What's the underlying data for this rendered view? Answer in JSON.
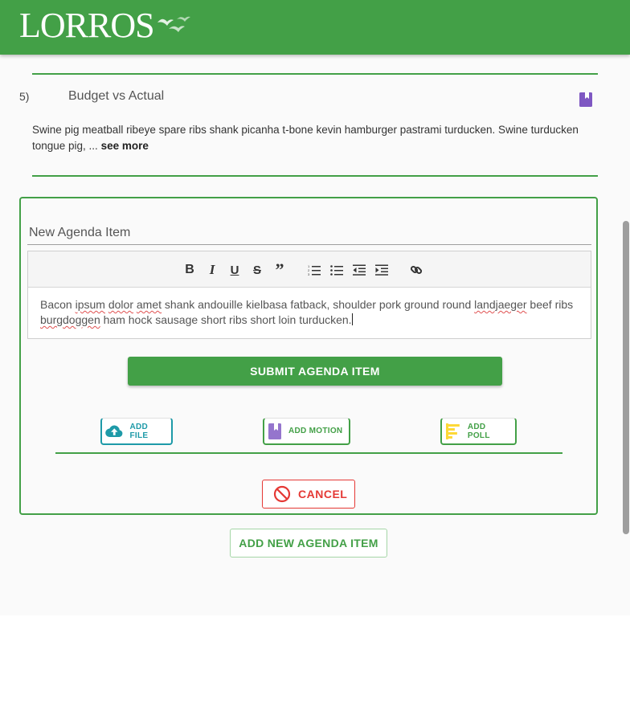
{
  "header": {
    "logo_text": "LORROS",
    "brand_color": "#43a047"
  },
  "agenda_item": {
    "number": "5)",
    "title": "Budget vs Actual",
    "description": "Swine pig meatball ribeye spare ribs shank picanha t-bone kevin hamburger pastrami turducken. Swine turducken tongue pig, ... ",
    "see_more_label": "see more",
    "icon": "motion-book-icon"
  },
  "new_item_form": {
    "title_placeholder": "New Agenda Item",
    "editor": {
      "toolbar": [
        "bold",
        "italic",
        "underline",
        "strikethrough",
        "blockquote",
        "ordered-list",
        "bullet-list",
        "outdent",
        "indent",
        "link"
      ],
      "content_segments": [
        "Bacon ",
        "ipsum",
        " ",
        "dolor",
        " ",
        "amet",
        " shank andouille kielbasa fatback, shoulder pork ground round ",
        "landjaeger",
        " beef ribs ",
        "burgdoggen",
        " ham hock sausage short ribs short loin turducken."
      ]
    },
    "submit_label": "SUBMIT AGENDA ITEM",
    "add_file_label": "ADD FILE",
    "add_motion_label": "ADD MOTION",
    "add_poll_label": "ADD POLL",
    "cancel_label": "CANCEL"
  },
  "add_new_agenda_label": "ADD NEW AGENDA ITEM",
  "colors": {
    "primary_green": "#43a047",
    "cancel_red": "#e53935",
    "file_teal": "#1e9aa8",
    "motion_purple": "#7e57c2",
    "poll_yellow": "#fdd835"
  }
}
